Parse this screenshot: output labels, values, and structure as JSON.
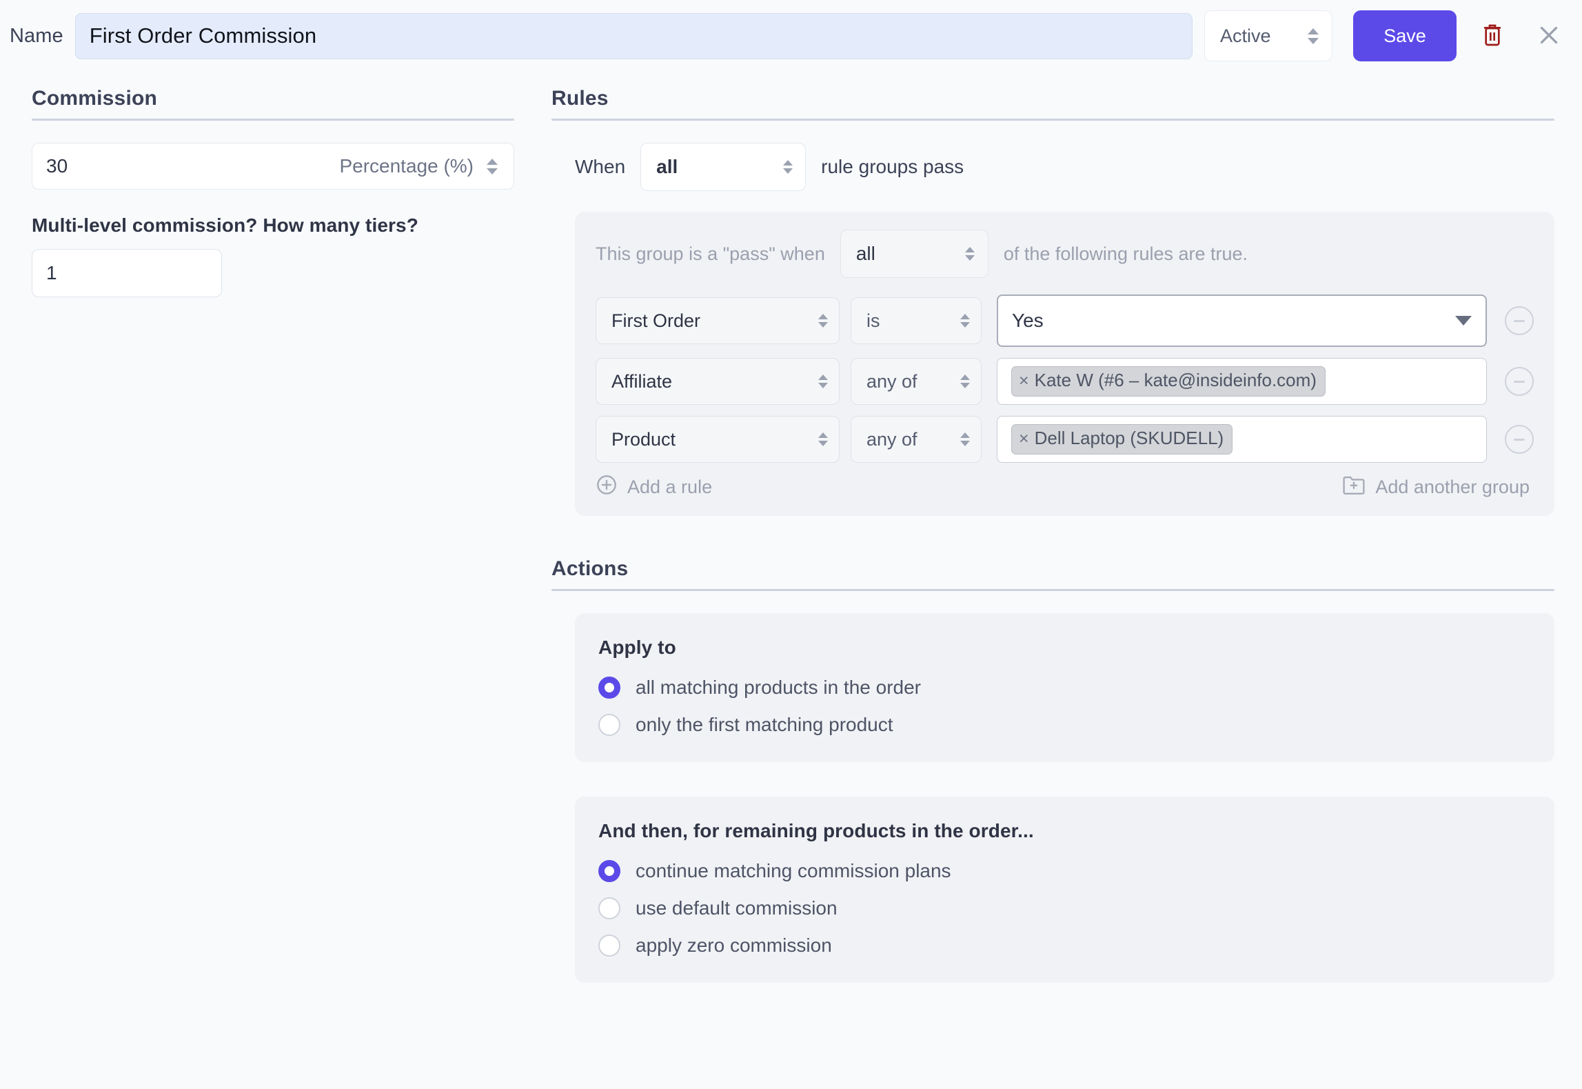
{
  "topbar": {
    "name_label": "Name",
    "name_value": "First Order Commission",
    "name_placeholder": "Name",
    "status_value": "Active",
    "save_label": "Save",
    "delete_icon": "trash-icon",
    "close_icon": "close-icon",
    "accent_color": "#5b4ae8",
    "delete_color": "#a01b1b"
  },
  "commission": {
    "section_title": "Commission",
    "amount_value": "30",
    "unit_value": "Percentage (%)",
    "tiers_label": "Multi-level commission? How many tiers?",
    "tiers_value": "1"
  },
  "rules": {
    "section_title": "Rules",
    "when_prefix": "When",
    "when_value": "all",
    "when_suffix": "rule groups pass",
    "group": {
      "lead_text": "This group is a \"pass\" when",
      "match_value": "all",
      "trail_text": "of the following rules are true.",
      "rows": [
        {
          "field": "First Order",
          "operator": "is",
          "value_type": "dropdown",
          "value": "Yes",
          "tags": []
        },
        {
          "field": "Affiliate",
          "operator": "any of",
          "value_type": "tags",
          "value": "",
          "tags": [
            "Kate W (#6 – kate@insideinfo.com)"
          ]
        },
        {
          "field": "Product",
          "operator": "any of",
          "value_type": "tags",
          "value": "",
          "tags": [
            "Dell Laptop (SKUDELL)"
          ]
        }
      ],
      "add_rule_label": "Add a rule",
      "add_group_label": "Add another group"
    }
  },
  "actions": {
    "section_title": "Actions",
    "apply_to": {
      "title": "Apply to",
      "options": [
        {
          "label": "all matching products in the order",
          "selected": true
        },
        {
          "label": "only the first matching product",
          "selected": false
        }
      ]
    },
    "remaining": {
      "title": "And then, for remaining products in the order...",
      "options": [
        {
          "label": "continue matching commission plans",
          "selected": true
        },
        {
          "label": "use default commission",
          "selected": false
        },
        {
          "label": "apply zero commission",
          "selected": false
        }
      ]
    }
  }
}
